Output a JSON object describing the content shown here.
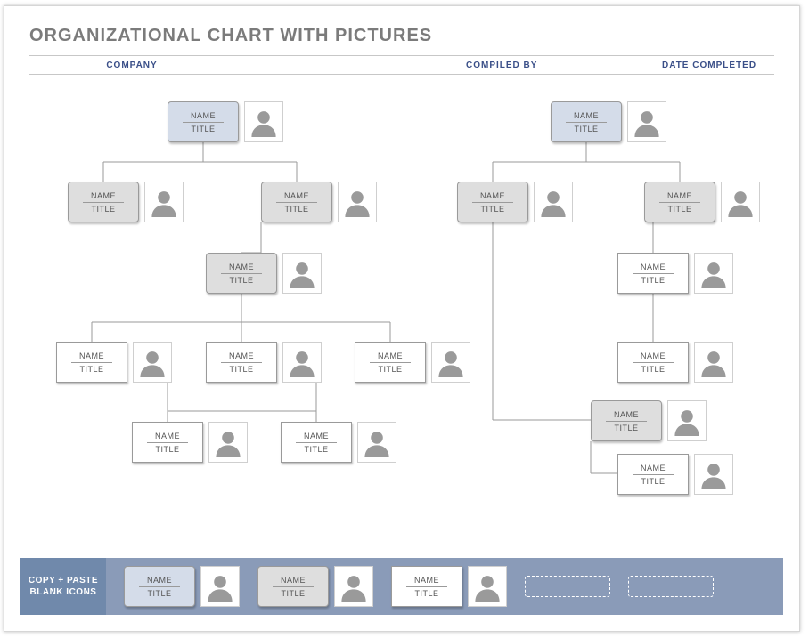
{
  "title": "ORGANIZATIONAL CHART WITH PICTURES",
  "header": {
    "company": "COMPANY",
    "compiled": "COMPILED BY",
    "date": "DATE COMPLETED"
  },
  "labels": {
    "name": "NAME",
    "title": "TITLE"
  },
  "palette": {
    "caption": "COPY + PASTE BLANK ICONS",
    "slots": [
      "blue",
      "grey",
      "white"
    ]
  },
  "nodes": {
    "left_root": {
      "name": "NAME",
      "title": "TITLE",
      "style": "blue"
    },
    "left_l2a": {
      "name": "NAME",
      "title": "TITLE",
      "style": "grey"
    },
    "left_l2b": {
      "name": "NAME",
      "title": "TITLE",
      "style": "grey"
    },
    "left_l3": {
      "name": "NAME",
      "title": "TITLE",
      "style": "grey"
    },
    "left_l4a": {
      "name": "NAME",
      "title": "TITLE",
      "style": "white"
    },
    "left_l4b": {
      "name": "NAME",
      "title": "TITLE",
      "style": "white"
    },
    "left_l4c": {
      "name": "NAME",
      "title": "TITLE",
      "style": "white"
    },
    "left_l5a": {
      "name": "NAME",
      "title": "TITLE",
      "style": "white"
    },
    "left_l5b": {
      "name": "NAME",
      "title": "TITLE",
      "style": "white"
    },
    "right_root": {
      "name": "NAME",
      "title": "TITLE",
      "style": "blue"
    },
    "right_l2a": {
      "name": "NAME",
      "title": "TITLE",
      "style": "grey"
    },
    "right_l2b": {
      "name": "NAME",
      "title": "TITLE",
      "style": "grey"
    },
    "right_l3": {
      "name": "NAME",
      "title": "TITLE",
      "style": "white"
    },
    "right_l4": {
      "name": "NAME",
      "title": "TITLE",
      "style": "white"
    },
    "right_s1": {
      "name": "NAME",
      "title": "TITLE",
      "style": "grey"
    },
    "right_s2": {
      "name": "NAME",
      "title": "TITLE",
      "style": "white"
    }
  }
}
